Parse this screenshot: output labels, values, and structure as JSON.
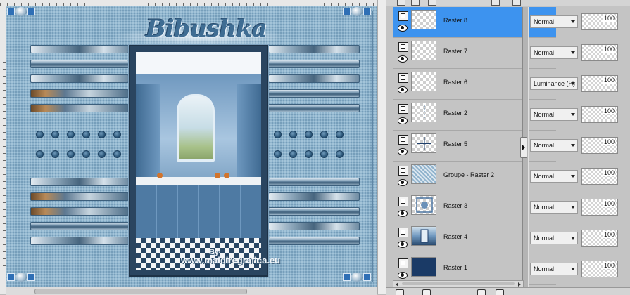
{
  "canvas": {
    "title": "Bibushka",
    "watermark_by": "By",
    "watermark_site": "www.maidiregrafica.eu"
  },
  "layers": [
    {
      "name": "Raster 8",
      "blend": "Normal",
      "opacity": "100",
      "selected": true,
      "thumb": "transparent"
    },
    {
      "name": "Raster 7",
      "blend": "Normal",
      "opacity": "100",
      "selected": false,
      "thumb": "transparent"
    },
    {
      "name": "Raster 6",
      "blend": "Luminance (H)",
      "opacity": "100",
      "selected": false,
      "thumb": "transparent"
    },
    {
      "name": "Raster 2",
      "blend": "Normal",
      "opacity": "100",
      "selected": false,
      "thumb": "lines"
    },
    {
      "name": "Raster 5",
      "blend": "Normal",
      "opacity": "100",
      "selected": false,
      "thumb": "cross"
    },
    {
      "name": "Groupe - Raster 2",
      "blend": "Normal",
      "opacity": "100",
      "selected": false,
      "thumb": "pattern"
    },
    {
      "name": "Raster 3",
      "blend": "Normal",
      "opacity": "100",
      "selected": false,
      "thumb": "ornament"
    },
    {
      "name": "Raster 4",
      "blend": "Normal",
      "opacity": "100",
      "selected": false,
      "thumb": "frame"
    },
    {
      "name": "Raster 1",
      "blend": "Normal",
      "opacity": "100",
      "selected": false,
      "thumb": "navy"
    }
  ],
  "colors": {
    "selected_row": "#3d93ef",
    "raster1_fill": "#1a3a66",
    "canvas_bg": "#8fb4cd"
  }
}
